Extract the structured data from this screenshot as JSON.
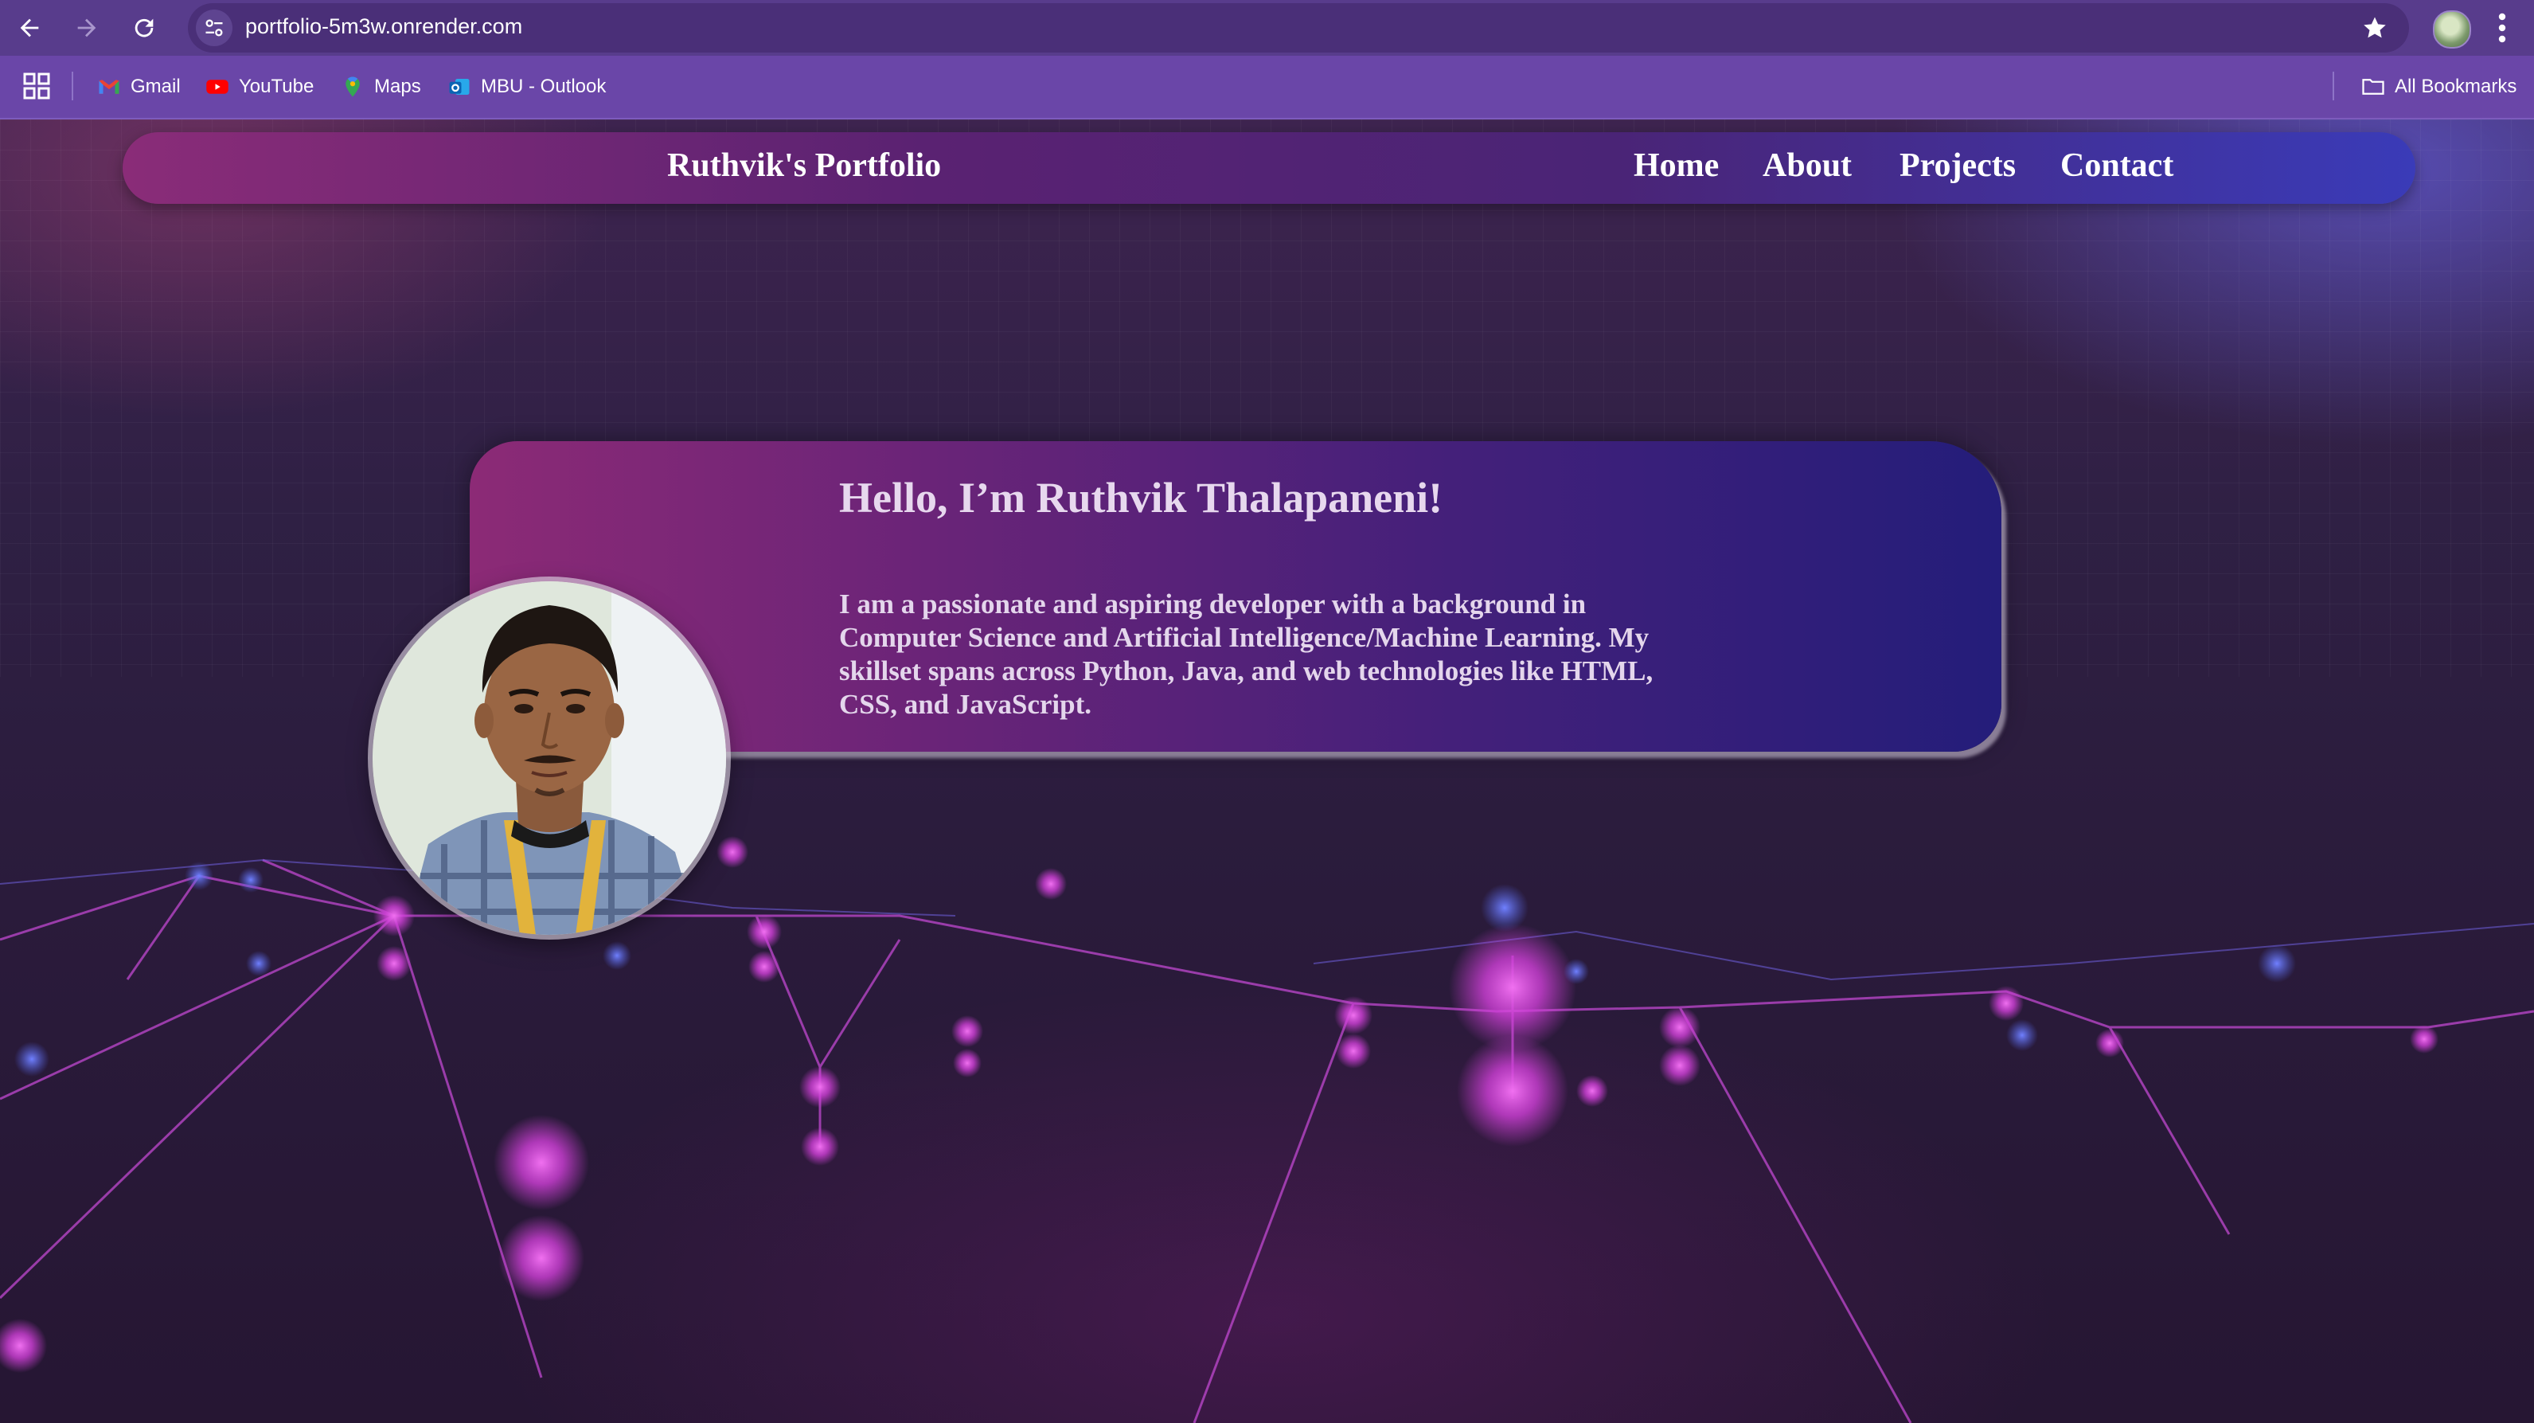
{
  "browser": {
    "url": "portfolio-5m3w.onrender.com",
    "bookmarks": [
      {
        "label": "Gmail",
        "icon": "gmail-icon"
      },
      {
        "label": "YouTube",
        "icon": "youtube-icon"
      },
      {
        "label": "Maps",
        "icon": "maps-icon"
      },
      {
        "label": "MBU - Outlook",
        "icon": "outlook-icon"
      }
    ],
    "all_bookmarks_label": "All Bookmarks"
  },
  "site": {
    "brand": "Ruthvik's Portfolio",
    "nav": [
      {
        "label": "Home"
      },
      {
        "label": "About"
      },
      {
        "label": "Projects"
      },
      {
        "label": "Contact"
      }
    ]
  },
  "hero": {
    "title": "Hello, I’m Ruthvik Thalapaneni!",
    "description": "I am a passionate and aspiring developer with a background in Computer Science and Artificial Intelligence/Machine Learning. My skillset spans across Python, Java, and web technologies like HTML, CSS, and JavaScript."
  },
  "colors": {
    "chrome": "#583c8c",
    "bookmarks_bar": "#6a46a8",
    "nav_gradient_start": "#8a2c78",
    "nav_gradient_end": "#3a3bb8",
    "network_node": "#e040e0"
  }
}
